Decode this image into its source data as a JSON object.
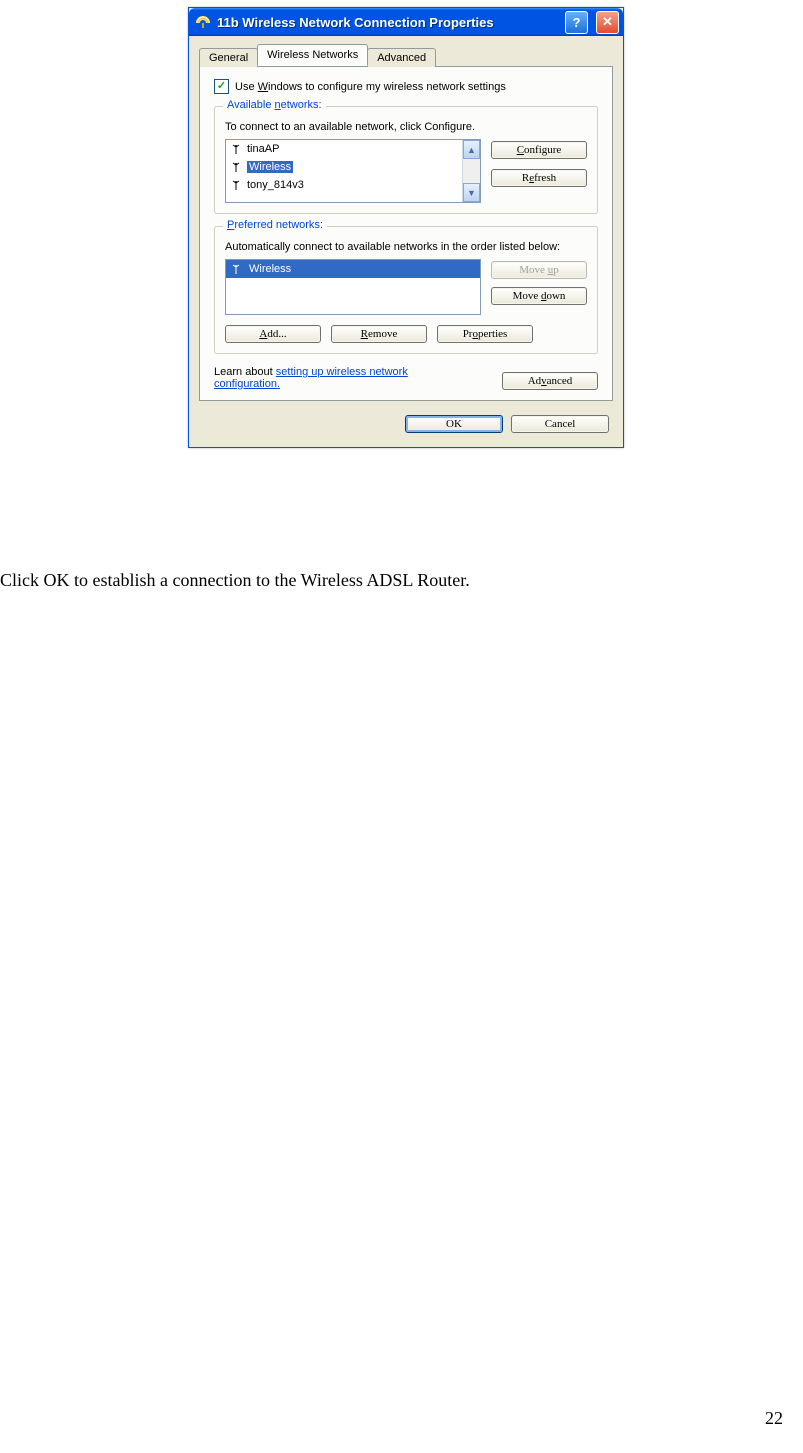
{
  "dialog": {
    "title": "11b Wireless Network Connection Properties",
    "tabs": {
      "general": "General",
      "wireless": "Wireless Networks",
      "advanced": "Advanced"
    },
    "check_label_pre": "Use ",
    "check_label_u": "W",
    "check_label_post": "indows to configure my wireless network settings",
    "available": {
      "legend_pre": "Available ",
      "legend_u": "n",
      "legend_post": "etworks:",
      "desc": "To connect to an available network, click Configure.",
      "items": [
        "tinaAP",
        "Wireless",
        "tony_814v3"
      ],
      "selected_index": 1,
      "configure_u": "C",
      "configure_post": "onfigure",
      "refresh_pre": "R",
      "refresh_u": "e",
      "refresh_post": "fresh"
    },
    "preferred": {
      "legend_u": "P",
      "legend_post": "referred networks:",
      "desc": "Automatically connect to available networks in the order listed below:",
      "items": [
        "Wireless"
      ],
      "moveup_pre": "Move ",
      "moveup_u": "u",
      "moveup_post": "p",
      "movedown_pre": "Move ",
      "movedown_u": "d",
      "movedown_post": "own",
      "add_u": "A",
      "add_post": "dd...",
      "remove_u": "R",
      "remove_post": "emove",
      "props_pre": "Pr",
      "props_u": "o",
      "props_post": "perties"
    },
    "learn_pre": "Learn about ",
    "learn_link": "setting up wireless network configuration.",
    "advanced_btn_pre": "Ad",
    "advanced_btn_u": "v",
    "advanced_btn_post": "anced",
    "ok": "OK",
    "cancel": "Cancel"
  },
  "caption": "Click OK to establish a connection to the Wireless ADSL Router.",
  "page_number": "22"
}
